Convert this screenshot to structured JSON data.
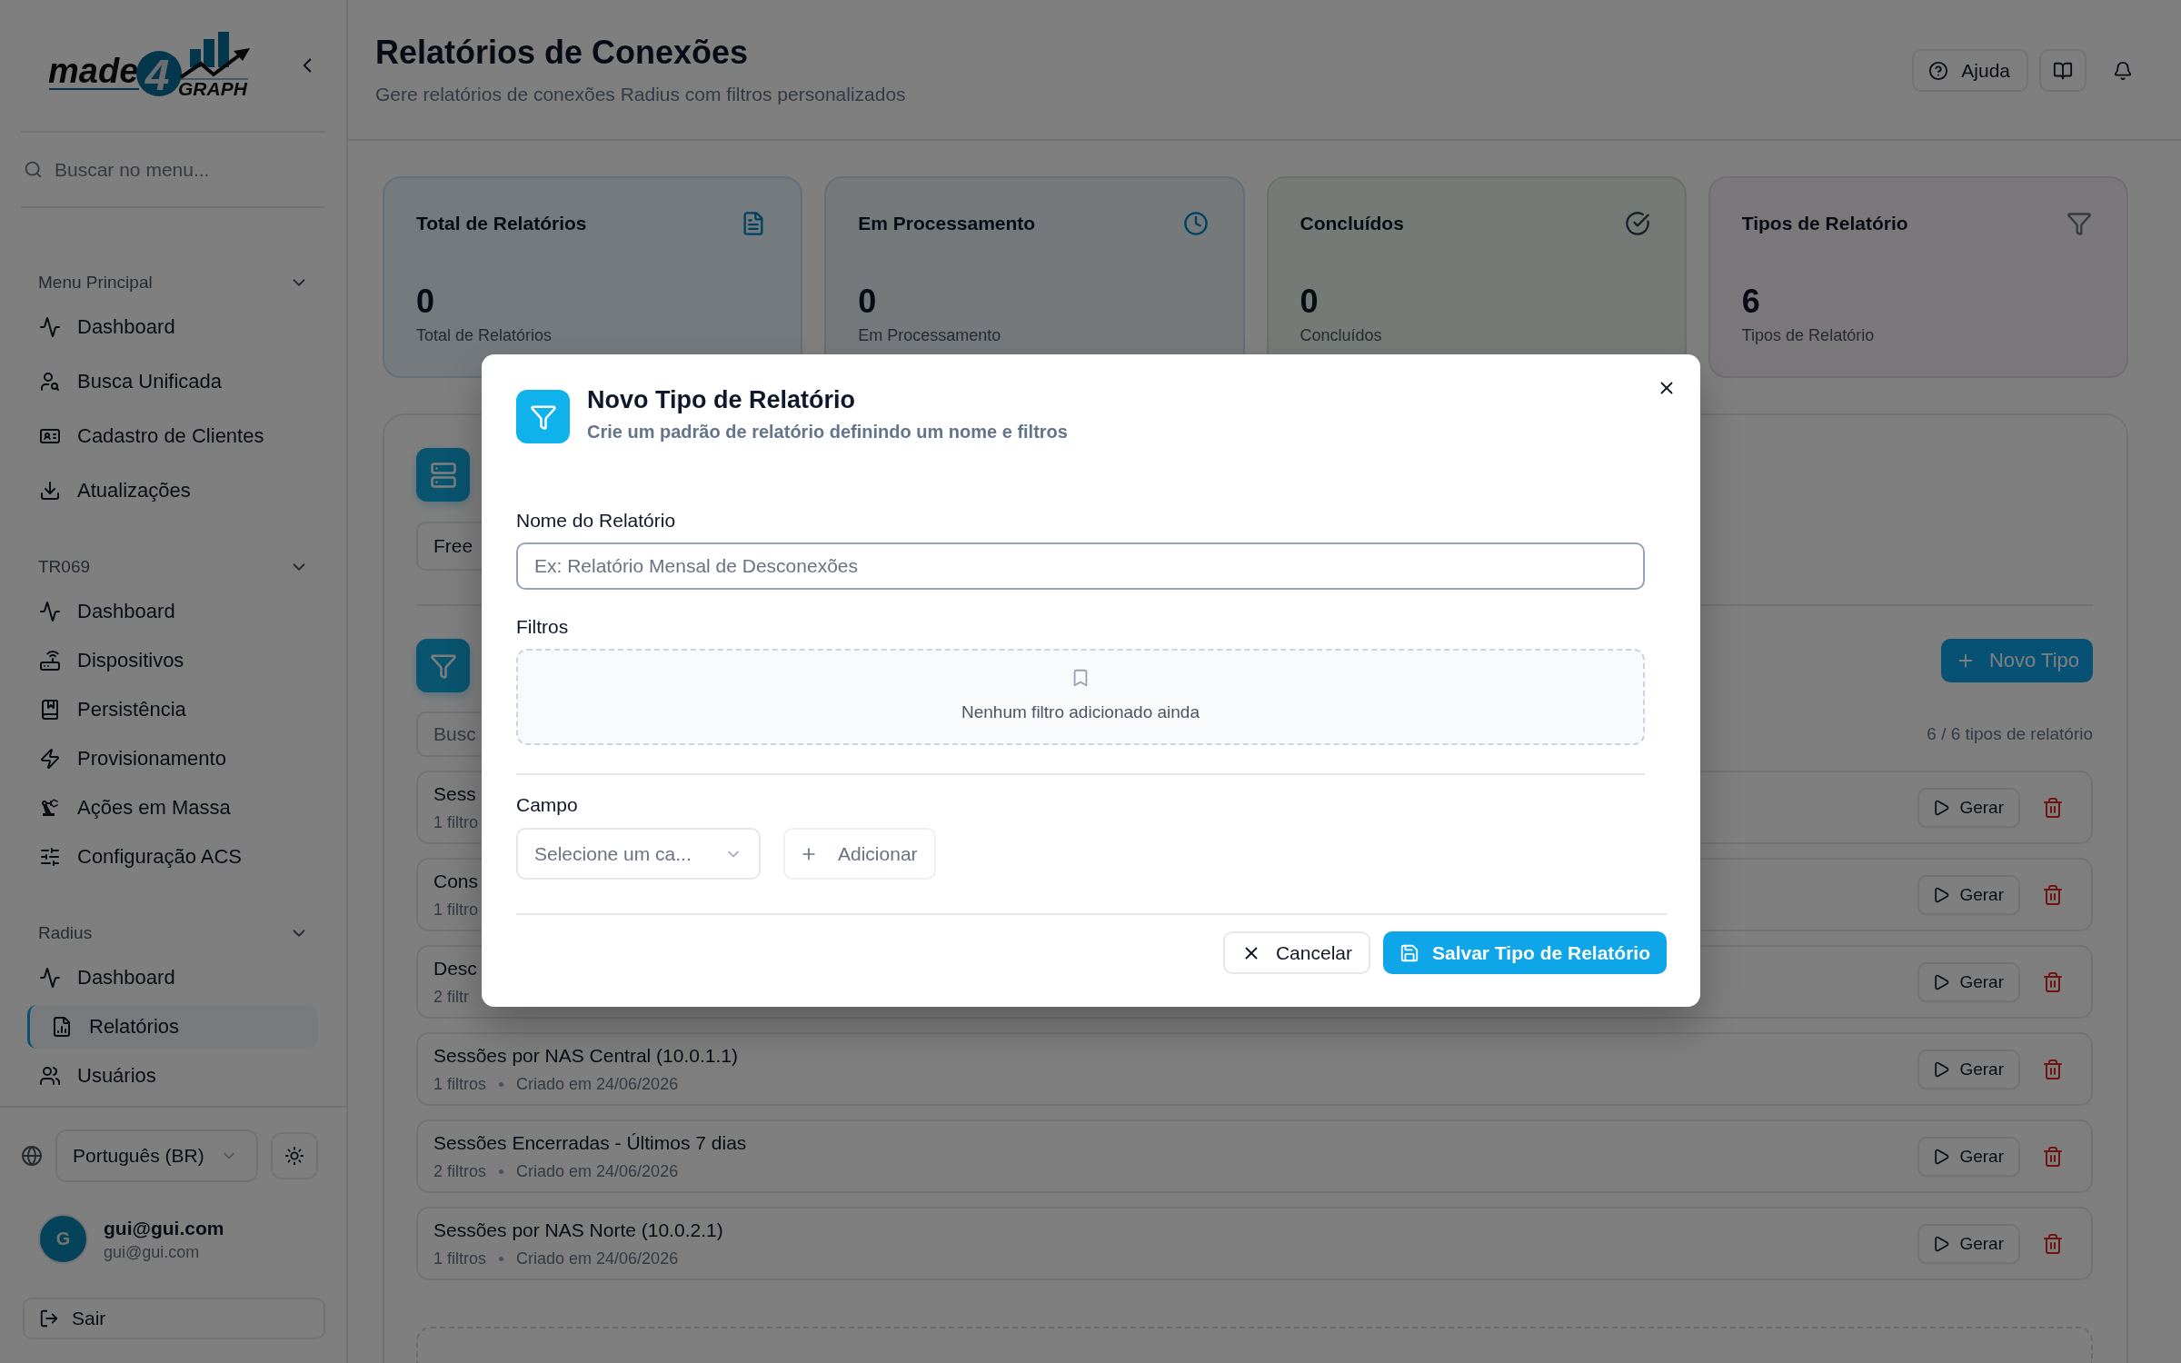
{
  "sidebar": {
    "logo": {
      "word": "made",
      "digit": "4",
      "suffix": "GRAPH"
    },
    "search": {
      "placeholder": "Buscar no menu..."
    },
    "sections": [
      {
        "title": "Menu Principal",
        "expanded": true,
        "items": [
          {
            "label": "Dashboard",
            "selected": false
          },
          {
            "label": "Busca Unificada",
            "selected": false
          },
          {
            "label": "Cadastro de Clientes",
            "selected": false
          },
          {
            "label": "Atualizações",
            "selected": false
          }
        ]
      },
      {
        "title": "TR069",
        "expanded": true,
        "items": [
          {
            "label": "Dashboard",
            "selected": false
          },
          {
            "label": "Dispositivos",
            "selected": false
          },
          {
            "label": "Persistência",
            "selected": false
          },
          {
            "label": "Provisionamento",
            "selected": false
          },
          {
            "label": "Ações em Massa",
            "selected": false
          },
          {
            "label": "Configuração ACS",
            "selected": false
          }
        ]
      },
      {
        "title": "Radius",
        "expanded": true,
        "items": [
          {
            "label": "Dashboard",
            "selected": false
          },
          {
            "label": "Relatórios",
            "selected": true
          },
          {
            "label": "Usuários",
            "selected": false
          }
        ]
      }
    ],
    "language": "Português (BR)",
    "user": {
      "initial": "G",
      "name": "gui@gui.com",
      "email": "gui@gui.com"
    },
    "logout": "Sair"
  },
  "header": {
    "title": "Relatórios de Conexões",
    "subtitle": "Gere relatórios de conexões Radius com filtros personalizados",
    "help_button": "Ajuda"
  },
  "stats": [
    {
      "title": "Total de Relatórios",
      "value": "0",
      "caption": "Total de Relatórios"
    },
    {
      "title": "Em Processamento",
      "value": "0",
      "caption": "Em Processamento"
    },
    {
      "title": "Concluídos",
      "value": "0",
      "caption": "Concluídos"
    },
    {
      "title": "Tipos de Relatório",
      "value": "6",
      "caption": "Tipos de Relatório"
    }
  ],
  "top_field": {
    "value": "Free"
  },
  "report_types": {
    "new_button": "Novo Tipo",
    "search": {
      "placeholder": "Busc"
    },
    "count": "6 / 6 tipos de relatório",
    "rows": [
      {
        "title": "Sess",
        "filters": "1 filtro",
        "action": "Gerar"
      },
      {
        "title": "Cons",
        "filters": "1 filtro",
        "action": "Gerar"
      },
      {
        "title": "Desc",
        "filters": "2 filtr",
        "action": "Gerar"
      },
      {
        "title": "Sessões por NAS Central (10.0.1.1)",
        "filters": "1 filtros",
        "created": "Criado em 24/06/2026",
        "action": "Gerar"
      },
      {
        "title": "Sessões Encerradas - Últimos 7 dias",
        "filters": "2 filtros",
        "created": "Criado em 24/06/2026",
        "action": "Gerar"
      },
      {
        "title": "Sessões por NAS Norte (10.0.2.1)",
        "filters": "1 filtros",
        "created": "Criado em 24/06/2026",
        "action": "Gerar"
      }
    ]
  },
  "dialog": {
    "title": "Novo Tipo de Relatório",
    "subtitle": "Crie um padrão de relatório definindo um nome e filtros",
    "name_field": {
      "label": "Nome do Relatório",
      "placeholder": "Ex: Relatório Mensal de Desconexões"
    },
    "filters": {
      "label": "Filtros",
      "empty": "Nenhum filtro adicionado ainda"
    },
    "field_select": {
      "label": "Campo",
      "placeholder": "Selecione um ca..."
    },
    "add_button": {
      "label": "Adicionar",
      "disabled": true
    },
    "cancel": "Cancelar",
    "save": "Salvar Tipo de Relatório"
  }
}
